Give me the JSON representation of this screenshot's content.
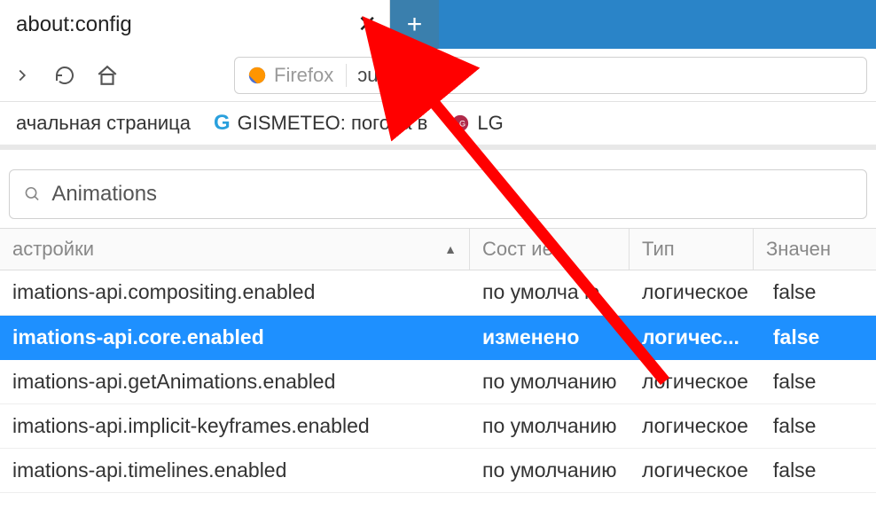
{
  "tab": {
    "title": "about:config"
  },
  "address": {
    "label": "Firefox",
    "url": "ɔut:config"
  },
  "bookmarks": {
    "b1": "ачальная страница",
    "b2": "GISMETEO: погода в",
    "b3": "LG"
  },
  "search": {
    "value": "Animations"
  },
  "columns": {
    "name": "астройки",
    "state": "Сост     ие",
    "type": "Тип",
    "value": "Значен"
  },
  "rows": [
    {
      "name": "imations-api.compositing.enabled",
      "state": "по умолча    ю",
      "type": "логическое",
      "value": "false"
    },
    {
      "name": "imations-api.core.enabled",
      "state": "изменено",
      "type": "логичес...",
      "value": "false"
    },
    {
      "name": "imations-api.getAnimations.enabled",
      "state": "по умолчанию",
      "type": "логическое",
      "value": "false"
    },
    {
      "name": "imations-api.implicit-keyframes.enabled",
      "state": "по умолчанию",
      "type": "логическое",
      "value": "false"
    },
    {
      "name": "imations-api.timelines.enabled",
      "state": "по умолчанию",
      "type": "логическое",
      "value": "false"
    }
  ]
}
